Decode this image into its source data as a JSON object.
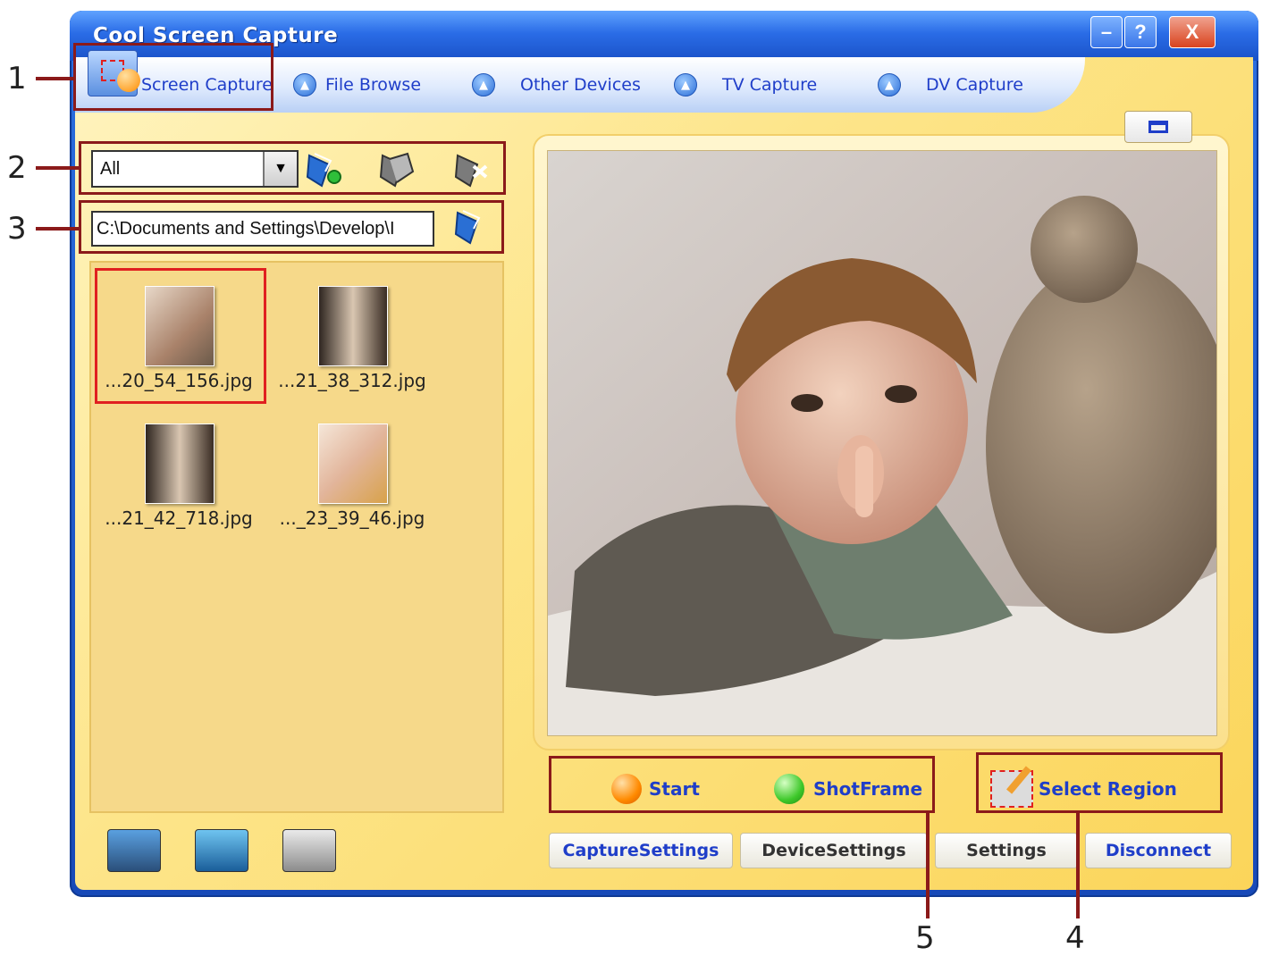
{
  "window": {
    "title": "Cool Screen Capture",
    "controls": {
      "minimize": "–",
      "help": "?",
      "close": "X"
    }
  },
  "tabs": [
    {
      "label": "Screen Capture",
      "icon": "screen-capture-icon"
    },
    {
      "label": "File Browse",
      "icon": "nav-arrow-icon"
    },
    {
      "label": "Other Devices",
      "icon": "nav-arrow-icon"
    },
    {
      "label": "TV Capture",
      "icon": "nav-arrow-icon"
    },
    {
      "label": "DV Capture",
      "icon": "nav-arrow-icon"
    }
  ],
  "left_panel": {
    "filter_value": "All",
    "path_value": "C:\\Documents and Settings\\Develop\\I",
    "files": [
      {
        "name": "...20_54_156.jpg",
        "selected": true
      },
      {
        "name": "...21_38_312.jpg",
        "selected": false
      },
      {
        "name": "...21_42_718.jpg",
        "selected": false
      },
      {
        "name": "..._23_39_46.jpg",
        "selected": false
      }
    ]
  },
  "controls": {
    "start_label": "Start",
    "shotframe_label": "ShotFrame",
    "select_region_label": "Select Region"
  },
  "bottom_buttons": {
    "capture_settings": "CaptureSettings",
    "device_settings": "DeviceSettings",
    "settings": "Settings",
    "disconnect": "Disconnect"
  },
  "callouts": {
    "c1": "1",
    "c2": "2",
    "c3": "3",
    "c4": "4",
    "c5": "5"
  },
  "colors": {
    "accent_blue": "#1f3ec9",
    "annotation_red": "#8b1a1a",
    "panel_yellow": "#fbd55a"
  }
}
